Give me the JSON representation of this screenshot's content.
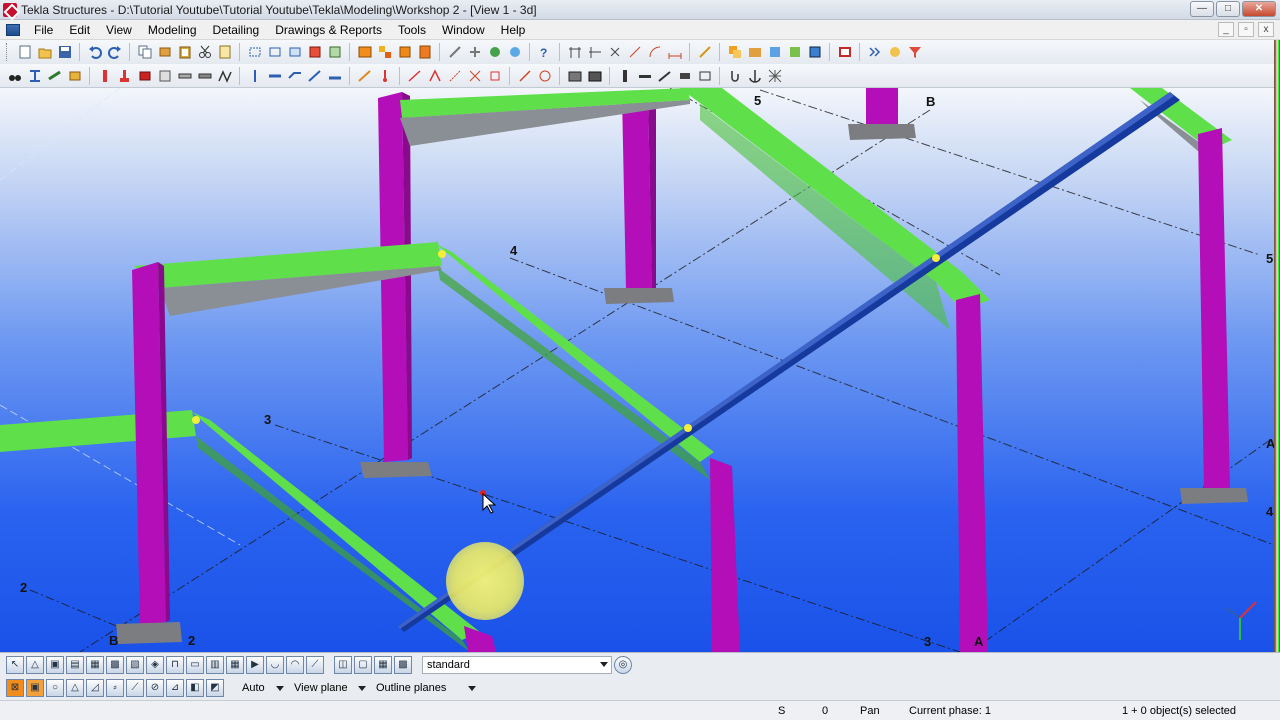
{
  "window": {
    "title": "Tekla Structures - D:\\Tutorial Youtube\\Tutorial Youtube\\Tekla\\Modeling\\Workshop 2  - [View 1 - 3d]",
    "min_label": "—",
    "max_label": "□",
    "close_label": "✕"
  },
  "menu": {
    "items": [
      "File",
      "Edit",
      "View",
      "Modeling",
      "Detailing",
      "Drawings & Reports",
      "Tools",
      "Window",
      "Help"
    ],
    "doc_min": "_",
    "doc_restore": "▫",
    "doc_close": "x"
  },
  "viewport": {
    "grid_labels": [
      "5",
      "B",
      "4",
      "5",
      "3",
      "A",
      "4",
      "2",
      "B",
      "2",
      "3",
      "A"
    ],
    "colors": {
      "column": "#b30eb8",
      "beam": "#5fe04a",
      "brace": "#15399c",
      "haunch": "#8a8f96",
      "base_plate": "#7b7d80",
      "background_top": "#f3f6fb",
      "background_bottom": "#1a52e9"
    }
  },
  "bottom_toolbar": {
    "selection_filter": "standard",
    "snap_mode": "Auto",
    "work_plane": "View plane",
    "outline_mode": "Outline planes"
  },
  "status": {
    "field_s": "S",
    "field_value": "0",
    "mode": "Pan",
    "phase": "Current phase: 1",
    "selection": "1 + 0 object(s) selected"
  }
}
